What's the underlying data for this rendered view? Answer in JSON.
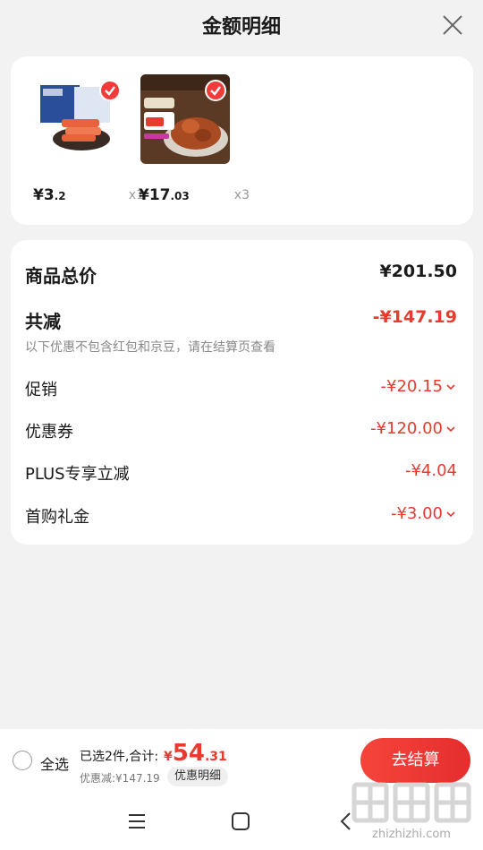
{
  "header": {
    "title": "金额明细",
    "close_icon": "close-icon"
  },
  "products": [
    {
      "price_int": "¥3",
      "price_dec": ".2",
      "qty": "x1",
      "image_icon": "crab-stick-snack"
    },
    {
      "price_int": "¥17",
      "price_dec": ".03",
      "qty": "x3",
      "image_icon": "braised-meat-dish"
    }
  ],
  "summary": {
    "total_label": "商品总价",
    "total_value": "¥201.50",
    "reduce_label": "共减",
    "reduce_value": "-¥147.19",
    "note": "以下优惠不包含红包和京豆，请在结算页查看",
    "items": [
      {
        "label": "促销",
        "value": "-¥20.15",
        "expandable": true
      },
      {
        "label": "优惠券",
        "value": "-¥120.00",
        "expandable": true
      },
      {
        "label": "PLUS专享立减",
        "value": "-¥4.04",
        "expandable": false
      },
      {
        "label": "首购礼金",
        "value": "-¥3.00",
        "expandable": true
      }
    ]
  },
  "bottom": {
    "select_all": "全选",
    "selected_text": "已选2件,合计:",
    "yen": "¥",
    "amount_int": "54",
    "amount_dec": ".31",
    "discount_text": "优惠减:¥147.19",
    "detail_button": "优惠明细",
    "checkout_button": "去结算"
  },
  "nav": {
    "menu_icon": "menu-icon",
    "home_icon": "home-icon",
    "back_icon": "back-icon"
  },
  "colors": {
    "accent": "#e63b2e",
    "background": "#f2f2f2"
  }
}
